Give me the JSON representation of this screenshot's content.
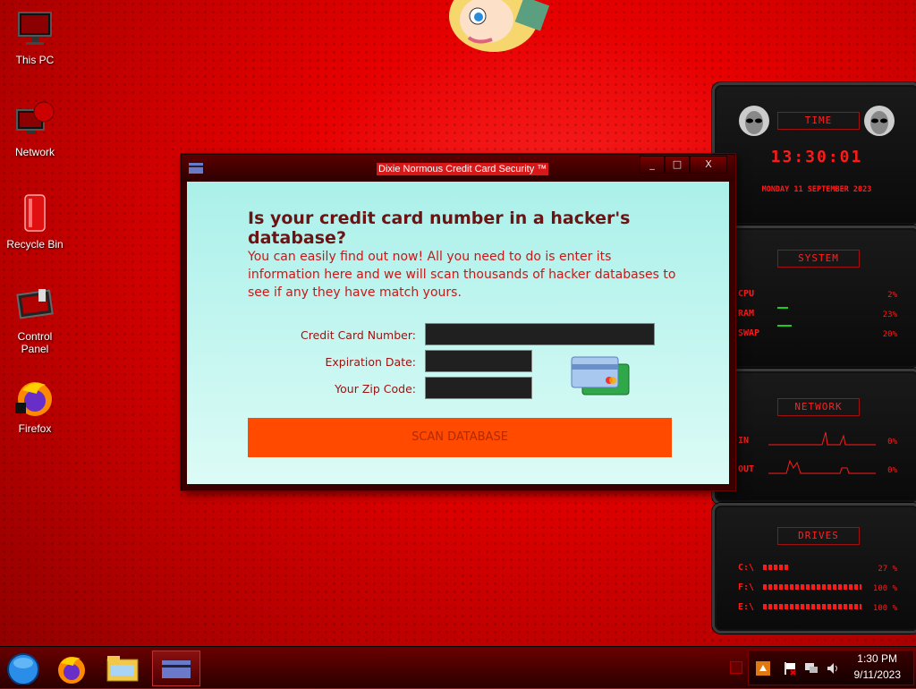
{
  "desktop": {
    "icons": [
      {
        "label": "This PC"
      },
      {
        "label": "Network"
      },
      {
        "label": "Recycle Bin"
      },
      {
        "label": "Control Panel"
      },
      {
        "label": "Firefox"
      }
    ]
  },
  "window": {
    "title": "Dixie Normous Credit Card Security ™",
    "controls": {
      "minimize": "_",
      "maximize": "□",
      "close": "X"
    },
    "headline": "Is your credit card number in a hacker's database?",
    "paragraph": "You can easily find out now! All you need to do is enter its information here and we will scan thousands of hacker databases to see if any they have match yours.",
    "form": {
      "card_number_label": "Credit Card Number:",
      "expiration_label": "Expiration Date:",
      "zip_label": "Your Zip Code:",
      "card_number_value": "",
      "expiration_value": "",
      "zip_value": ""
    },
    "scan_button": "SCAN DATABASE"
  },
  "gadgets": {
    "time": {
      "title": "TIME",
      "clock": "13:30:01",
      "date": "MONDAY 11 SEPTEMBER 2023"
    },
    "system": {
      "title": "SYSTEM",
      "rows": [
        {
          "label": "CPU",
          "value": "2%"
        },
        {
          "label": "RAM",
          "value": "23%"
        },
        {
          "label": "SWAP",
          "value": "20%"
        }
      ]
    },
    "network": {
      "title": "NETWORK",
      "rows": [
        {
          "label": "IN",
          "value": "0%"
        },
        {
          "label": "OUT",
          "value": "0%"
        }
      ]
    },
    "drives": {
      "title": "DRIVES",
      "rows": [
        {
          "label": "C:\\",
          "value": "27 %"
        },
        {
          "label": "F:\\",
          "value": "100 %"
        },
        {
          "label": "E:\\",
          "value": "100 %"
        }
      ]
    }
  },
  "taskbar": {
    "clock_time": "1:30 PM",
    "clock_date": "9/11/2023"
  },
  "colors": {
    "accent": "#ff4a00",
    "window_bg": "#abf0ea",
    "desktop": "#e60000",
    "gadget_text": "#ff1a1a"
  }
}
